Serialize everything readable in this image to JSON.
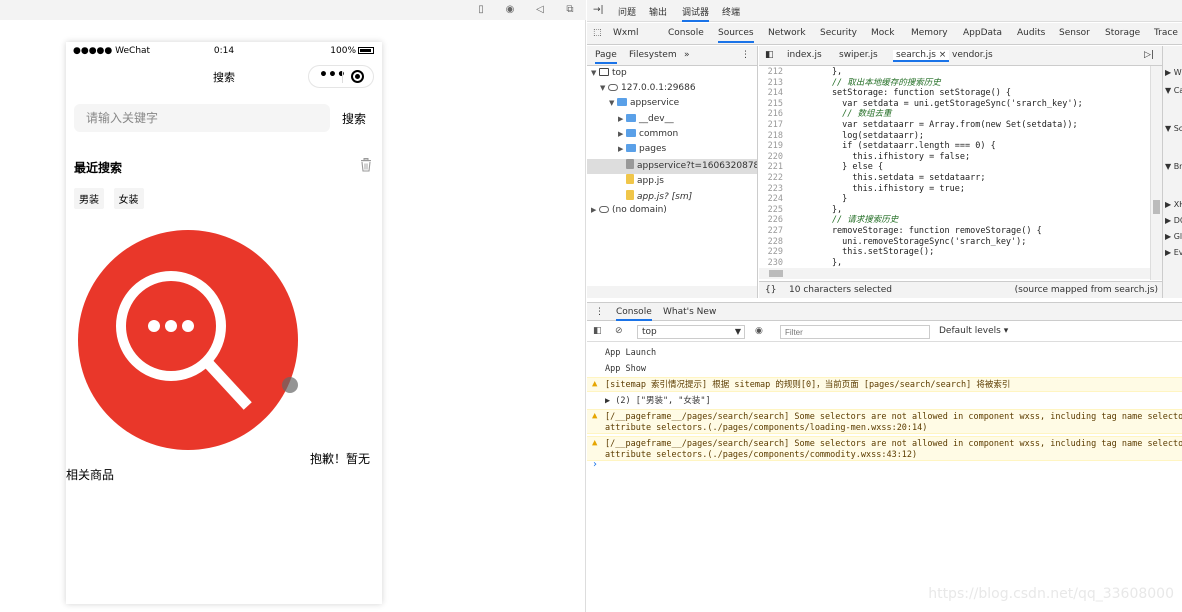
{
  "simulator": {
    "toolbar_icons": [
      "phone-icon",
      "record-icon",
      "volume-icon",
      "window-icon"
    ],
    "status_bar": {
      "carrier": "●●●●● WeChat",
      "time": "0:14",
      "battery": "100%"
    },
    "nav_title": "搜索",
    "capsule": {
      "more": "•••"
    },
    "search": {
      "placeholder": "请输入关键字",
      "button": "搜索"
    },
    "recent": {
      "title": "最近搜索",
      "tags": [
        "男装",
        "女装"
      ]
    },
    "empty": {
      "line1": "抱歉！暂无",
      "line2": "相关商品"
    },
    "colors": {
      "accent": "#e9372a"
    }
  },
  "devtools": {
    "top_tabs": [
      "问题",
      "输出",
      "调试器",
      "终端"
    ],
    "main_tabs": [
      "Wxml",
      "Console",
      "Sources",
      "Network",
      "Security",
      "Mock",
      "Memory",
      "AppData",
      "Audits",
      "Sensor",
      "Storage",
      "Trace"
    ],
    "active_main_tab": "Sources",
    "navigator_tabs": [
      "Page",
      "Filesystem",
      "»"
    ],
    "tree": [
      {
        "label": "top",
        "depth": 0,
        "fold": "▼",
        "icon": "frame"
      },
      {
        "label": "127.0.0.1:29686",
        "depth": 1,
        "fold": "▼",
        "icon": "cloud"
      },
      {
        "label": "appservice",
        "depth": 2,
        "fold": "▼",
        "icon": "folder"
      },
      {
        "label": "__dev__",
        "depth": 3,
        "fold": "▶",
        "icon": "folder"
      },
      {
        "label": "common",
        "depth": 3,
        "fold": "▶",
        "icon": "folder"
      },
      {
        "label": "pages",
        "depth": 3,
        "fold": "▶",
        "icon": "folder"
      },
      {
        "label": "appservice?t=1606320878544",
        "depth": 3,
        "fold": "",
        "icon": "gray",
        "selected": true
      },
      {
        "label": "app.js",
        "depth": 3,
        "fold": "",
        "icon": "js"
      },
      {
        "label": "app.js? [sm]",
        "depth": 3,
        "fold": "",
        "icon": "js"
      },
      {
        "label": "(no domain)",
        "depth": 0,
        "fold": "▶",
        "icon": "cloud"
      }
    ],
    "file_tabs": [
      "index.js",
      "swiper.js",
      "search.js ×",
      "vendor.js"
    ],
    "active_file_tab": "search.js ×",
    "code": [
      {
        "n": "212",
        "t": "        },"
      },
      {
        "n": "213",
        "t": "        // 取出本地缓存的搜索历史"
      },
      {
        "n": "214",
        "t": "        setStorage: function setStorage() {"
      },
      {
        "n": "215",
        "t": "          var setdata = uni.getStorageSync('srarch_key');"
      },
      {
        "n": "216",
        "t": "          // 数组去重"
      },
      {
        "n": "217",
        "t": "          var setdataarr = Array.from(new Set(setdata));"
      },
      {
        "n": "218",
        "t": "          log(setdataarr);"
      },
      {
        "n": "219",
        "t": "          if (setdataarr.length === 0) {"
      },
      {
        "n": "220",
        "t": "            this.ifhistory = false;"
      },
      {
        "n": "221",
        "t": "          } else {"
      },
      {
        "n": "222",
        "t": "            this.setdata = setdataarr;"
      },
      {
        "n": "223",
        "t": "            this.ifhistory = true;"
      },
      {
        "n": "224",
        "t": "          }"
      },
      {
        "n": "225",
        "t": "        },"
      },
      {
        "n": "226",
        "t": "        // 请求搜索历史"
      },
      {
        "n": "227",
        "t": "        removeStorage: function removeStorage() {"
      },
      {
        "n": "228",
        "t": "          uni.removeStorageSync('srarch_key');"
      },
      {
        "n": "229",
        "t": "          this.setStorage();"
      },
      {
        "n": "230",
        "t": "        },"
      },
      {
        "n": "231",
        "t": ""
      }
    ],
    "status": {
      "braces": "{}",
      "selection": "10 characters selected",
      "source_map": "(source mapped from search.js)"
    },
    "right_panel": [
      "▶ W",
      "▼ Ca",
      "▼ Sc",
      "▼ Br",
      "▶ XH",
      "▶ DO",
      "▶ Gl",
      "▶ Ev"
    ],
    "console_tabs": [
      "Console",
      "What's New"
    ],
    "active_console_tab": "Console",
    "console_toolbar": {
      "context": "top",
      "filter_placeholder": "Filter",
      "levels": "Default levels ▾"
    },
    "messages": [
      {
        "type": "log",
        "text": "App Launch"
      },
      {
        "type": "log",
        "text": "App Show"
      },
      {
        "type": "warn",
        "text": "[sitemap 索引情况提示] 根据 sitemap 的规则[0]，当前页面 [pages/search/search] 将被索引"
      },
      {
        "type": "log",
        "text": "▶ (2) [\"男装\", \"女装\"]"
      },
      {
        "type": "warn",
        "text": "[/__pageframe__/pages/search/search] Some selectors are not allowed in component wxss, including tag name selectors\nattribute selectors.(./pages/components/loading-men.wxss:20:14)"
      },
      {
        "type": "warn",
        "text": "[/__pageframe__/pages/search/search] Some selectors are not allowed in component wxss, including tag name selectors\nattribute selectors.(./pages/components/commodity.wxss:43:12)"
      }
    ],
    "prompt": "›"
  },
  "watermark": "https://blog.csdn.net/qq_33608000"
}
